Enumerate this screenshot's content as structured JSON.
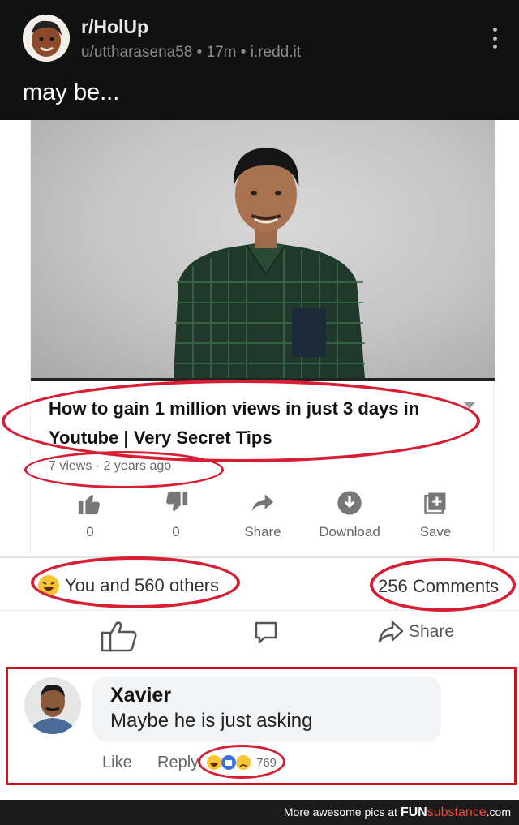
{
  "post": {
    "subreddit": "r/HolUp",
    "meta": "u/uttharasena58 • 17m • i.redd.it",
    "title": "may be..."
  },
  "video": {
    "title": "How to gain 1 million views in just 3 days in Youtube | Very Secret Tips",
    "meta": "7 views · 2 years ago",
    "actions": [
      {
        "icon": "thumbs-up-icon",
        "label": "0"
      },
      {
        "icon": "thumbs-down-icon",
        "label": "0"
      },
      {
        "icon": "share-arrow-icon",
        "label": "Share"
      },
      {
        "icon": "download-icon",
        "label": "Download"
      },
      {
        "icon": "save-playlist-icon",
        "label": "Save"
      }
    ]
  },
  "facebook": {
    "reactions_text": "You and 560 others",
    "comments_count": "256 Comments",
    "buttons": [
      {
        "icon": "like-thumb-icon",
        "label": ""
      },
      {
        "icon": "comment-bubble-icon",
        "label": ""
      },
      {
        "icon": "share-icon",
        "label": "Share"
      }
    ]
  },
  "comment": {
    "author": "Xavier",
    "text": "Maybe he is just asking",
    "like_label": "Like",
    "reply_label": "Reply",
    "reaction_count": "769"
  },
  "footer": {
    "prefix": "More awesome pics at ",
    "brand": "FUN",
    "brand_suffix": "substance",
    "domain": ".com"
  },
  "colors": {
    "header_bg": "#111111",
    "highlight_red": "#d61f35",
    "box_red": "#c4161c",
    "shirt_green": "#1f3a2a"
  }
}
